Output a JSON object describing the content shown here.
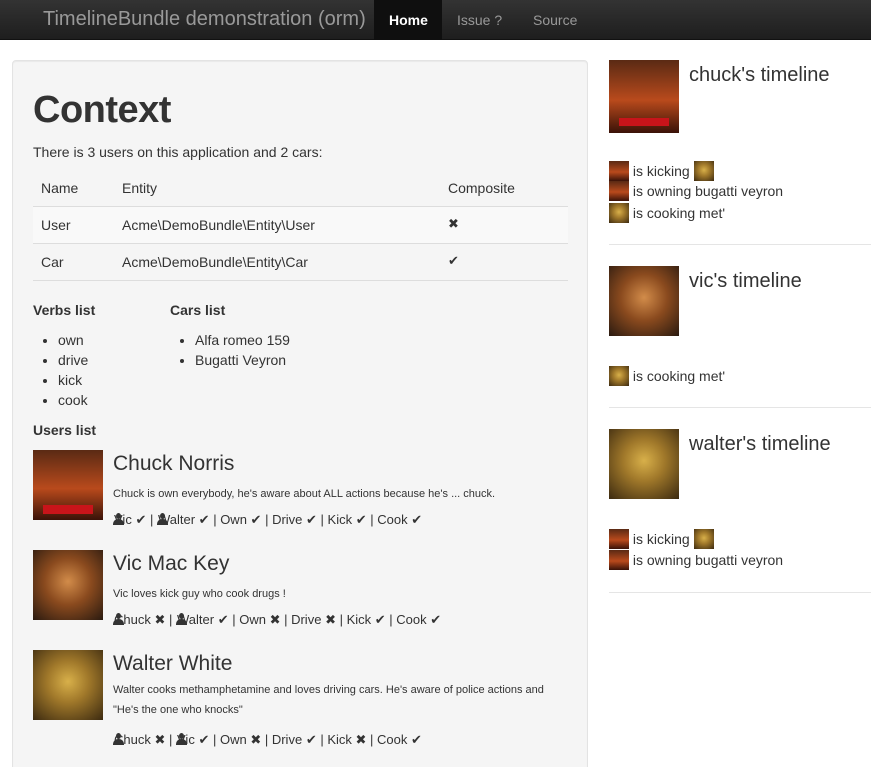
{
  "navbar": {
    "brand": "TimelineBundle demonstration (orm)",
    "items": [
      {
        "label": "Home",
        "active": true
      },
      {
        "label": "Issue ?",
        "active": false
      },
      {
        "label": "Source",
        "active": false
      }
    ]
  },
  "main": {
    "title": "Context",
    "intro": "There is 3 users on this application and 2 cars:",
    "table": {
      "headers": [
        "Name",
        "Entity",
        "Composite"
      ],
      "rows": [
        {
          "name": "User",
          "entity": "Acme\\DemoBundle\\Entity\\User",
          "composite": "✖"
        },
        {
          "name": "Car",
          "entity": "Acme\\DemoBundle\\Entity\\Car",
          "composite": "✔"
        }
      ]
    },
    "verbs_heading": "Verbs list",
    "verbs": [
      "own",
      "drive",
      "kick",
      "cook"
    ],
    "cars_heading": "Cars list",
    "cars": [
      "Alfa romeo 159",
      "Bugatti Veyron"
    ],
    "users_heading": "Users list",
    "users": [
      {
        "name": "Chuck Norris",
        "description": "Chuck is own everybody, he's aware about ALL actions because he's ... chuck.",
        "actions": [
          {
            "label": "Vic",
            "user": true,
            "mark": "✔"
          },
          {
            "label": "Walter",
            "user": true,
            "mark": "✔"
          },
          {
            "label": "Own",
            "user": false,
            "mark": "✔"
          },
          {
            "label": "Drive",
            "user": false,
            "mark": "✔"
          },
          {
            "label": "Kick",
            "user": false,
            "mark": "✔"
          },
          {
            "label": "Cook",
            "user": false,
            "mark": "✔"
          }
        ]
      },
      {
        "name": "Vic Mac Key",
        "description": "Vic loves kick guy who cook drugs !",
        "actions": [
          {
            "label": "Chuck",
            "user": true,
            "mark": "✖"
          },
          {
            "label": "Walter",
            "user": true,
            "mark": "✔"
          },
          {
            "label": "Own",
            "user": false,
            "mark": "✖"
          },
          {
            "label": "Drive",
            "user": false,
            "mark": "✖"
          },
          {
            "label": "Kick",
            "user": false,
            "mark": "✔"
          },
          {
            "label": "Cook",
            "user": false,
            "mark": "✔"
          }
        ]
      },
      {
        "name": "Walter White",
        "description": "Walter cooks methamphetamine and loves driving cars. He's aware of police actions and \"He's the one who knocks\"",
        "actions": [
          {
            "label": "Chuck",
            "user": true,
            "mark": "✖"
          },
          {
            "label": "Vic",
            "user": true,
            "mark": "✔"
          },
          {
            "label": "Own",
            "user": false,
            "mark": "✖"
          },
          {
            "label": "Drive",
            "user": false,
            "mark": "✔"
          },
          {
            "label": "Kick",
            "user": false,
            "mark": "✖"
          },
          {
            "label": "Cook",
            "user": false,
            "mark": "✔"
          }
        ]
      }
    ]
  },
  "sidebar": {
    "timelines": [
      {
        "title": "chuck's timeline",
        "avatar_label": "Chuck Norris",
        "entries": [
          {
            "text": "is kicking",
            "subject": "chuck",
            "target": "walter"
          },
          {
            "text": "is owning bugatti veyron",
            "subject": "chuck"
          },
          {
            "text": "is cooking met'",
            "subject": "walter"
          }
        ]
      },
      {
        "title": "vic's timeline",
        "entries": [
          {
            "text": "is cooking met'",
            "subject": "walter"
          }
        ]
      },
      {
        "title": "walter's timeline",
        "entries": [
          {
            "text": "is kicking",
            "subject": "chuck",
            "target": "walter"
          },
          {
            "text": "is owning bugatti veyron",
            "subject": "chuck"
          }
        ]
      }
    ]
  },
  "icons": {
    "check": "check-icon",
    "cross": "cross-icon",
    "user": "user-icon"
  }
}
